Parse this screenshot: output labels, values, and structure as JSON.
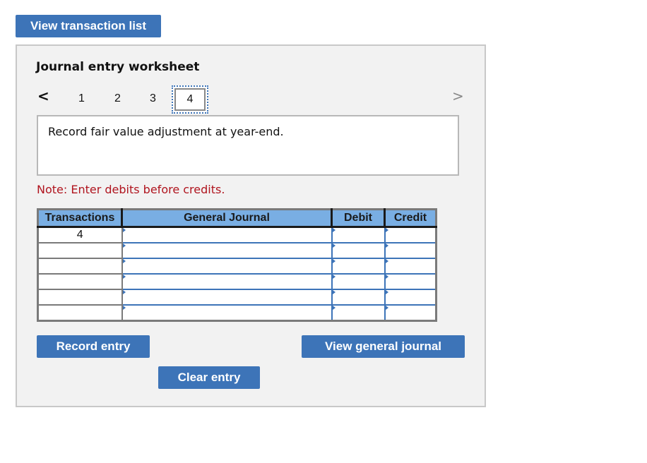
{
  "header": {
    "view_transaction_list": "View transaction list"
  },
  "worksheet": {
    "title": "Journal entry worksheet",
    "nav": {
      "prev_icon": "chevron-left-icon",
      "next_icon": "chevron-right-icon",
      "prev": "<",
      "next": ">"
    },
    "pages": [
      "1",
      "2",
      "3",
      "4"
    ],
    "active_page": "4",
    "description": "Record fair value adjustment at year-end.",
    "note": "Note: Enter debits before credits.",
    "table": {
      "headers": [
        "Transactions",
        "General Journal",
        "Debit",
        "Credit"
      ],
      "rows": [
        {
          "transaction": "4",
          "account": "",
          "debit": "",
          "credit": ""
        },
        {
          "transaction": "",
          "account": "",
          "debit": "",
          "credit": ""
        },
        {
          "transaction": "",
          "account": "",
          "debit": "",
          "credit": ""
        },
        {
          "transaction": "",
          "account": "",
          "debit": "",
          "credit": ""
        },
        {
          "transaction": "",
          "account": "",
          "debit": "",
          "credit": ""
        },
        {
          "transaction": "",
          "account": "",
          "debit": "",
          "credit": ""
        }
      ]
    },
    "buttons": {
      "record_entry": "Record entry",
      "clear_entry": "Clear entry",
      "view_general_journal": "View general journal"
    }
  },
  "colors": {
    "button_blue": "#3d74b8",
    "header_blue": "#79aee3",
    "note_red": "#b0141e"
  }
}
